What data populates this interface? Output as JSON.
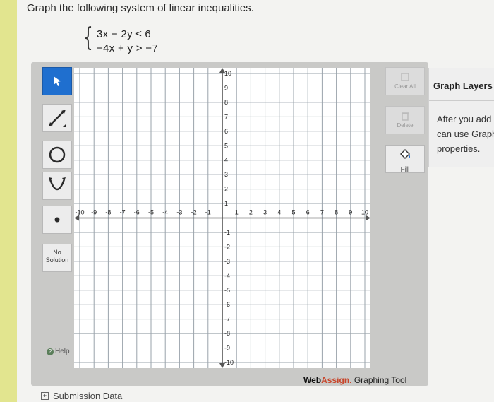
{
  "question": {
    "prompt": "Graph the following system of linear inequalities.",
    "brace": "{",
    "inequality_1": "3x − 2y ≤ 6",
    "inequality_2": "−4x + y > −7"
  },
  "toolbar": {
    "tools": [
      {
        "name": "pointer-tool",
        "icon": "arrow-cursor-icon",
        "active": true
      },
      {
        "name": "line-tool",
        "icon": "line-icon",
        "active": false
      },
      {
        "name": "circle-tool",
        "icon": "circle-icon",
        "active": false
      },
      {
        "name": "parabola-tool",
        "icon": "parabola-icon",
        "active": false
      },
      {
        "name": "point-tool",
        "icon": "point-icon",
        "active": false
      }
    ],
    "no_solution": "No Solution",
    "help": "Help"
  },
  "right_toolbar": {
    "clear_all": "Clear All",
    "delete": "Delete",
    "fill": "Fill"
  },
  "graph": {
    "x_range": [
      -10,
      10
    ],
    "y_range": [
      -10,
      10
    ],
    "grid": true,
    "x_tick_labels": [
      "-10",
      "-9",
      "-8",
      "-7",
      "-6",
      "-5",
      "-4",
      "-3",
      "-2",
      "-1",
      "1",
      "2",
      "3",
      "4",
      "5",
      "6",
      "7",
      "8",
      "9",
      "10"
    ],
    "y_tick_labels": [
      "10",
      "9",
      "8",
      "7",
      "6",
      "5",
      "4",
      "3",
      "2",
      "1",
      "-1",
      "-2",
      "-3",
      "-4",
      "-5",
      "-6",
      "-7",
      "-8",
      "-9",
      "-10"
    ]
  },
  "branding": {
    "web": "Web",
    "assign": "Assign.",
    "tool": "Graphing Tool"
  },
  "layers": {
    "title": "Graph Layers",
    "line1": "After you add",
    "line2": "can use Graph",
    "line3": "properties."
  },
  "footer": {
    "submission": "Submission Data"
  },
  "colors": {
    "accent": "#1f6fcf",
    "assign": "#c8452a",
    "grid_line": "#9aa3ab",
    "axis": "#555555"
  }
}
